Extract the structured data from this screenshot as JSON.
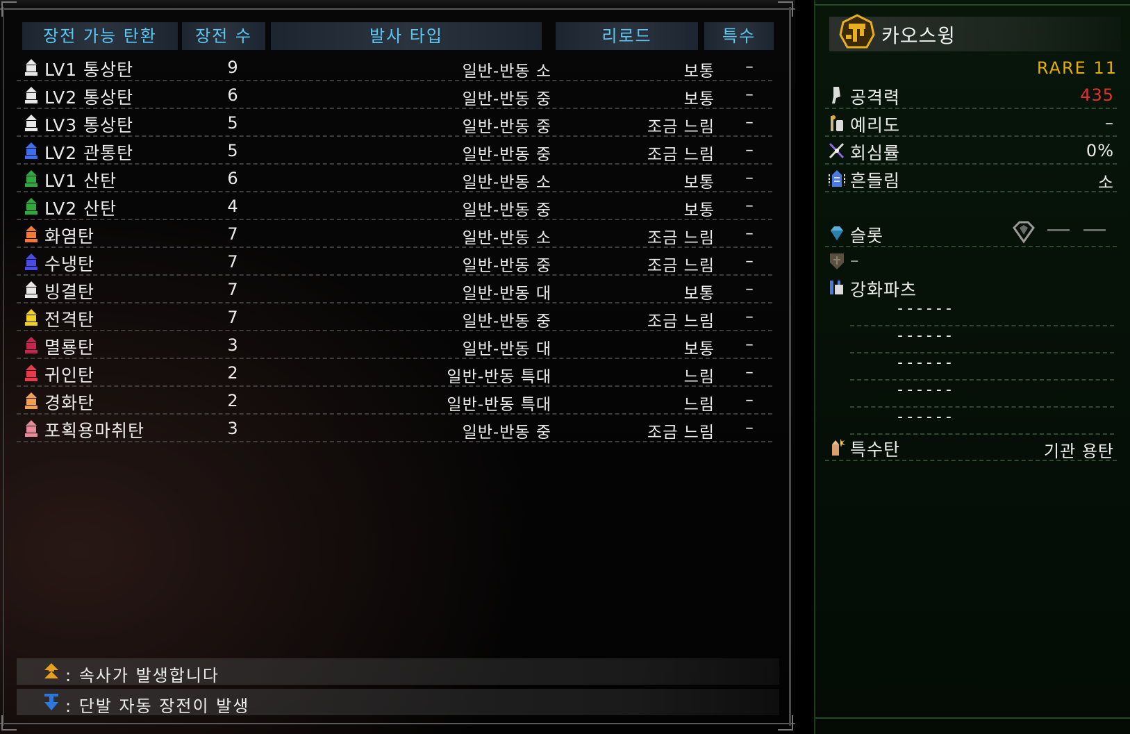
{
  "table": {
    "headers": {
      "ammo": "장전 가능 탄환",
      "capacity": "장전 수",
      "fire_type": "발사 타입",
      "reload": "리로드",
      "special": "특수"
    },
    "rows": [
      {
        "name": "LV1 통상탄",
        "count": "9",
        "fire": "일반-반동 소",
        "reload": "보통",
        "special": "–",
        "color": "#e8e8e8"
      },
      {
        "name": "LV2 통상탄",
        "count": "6",
        "fire": "일반-반동 중",
        "reload": "보통",
        "special": "–",
        "color": "#e8e8e8"
      },
      {
        "name": "LV3 통상탄",
        "count": "5",
        "fire": "일반-반동 중",
        "reload": "조금 느림",
        "special": "–",
        "color": "#e8e8e8"
      },
      {
        "name": "LV2 관통탄",
        "count": "5",
        "fire": "일반-반동 중",
        "reload": "조금 느림",
        "special": "–",
        "color": "#3b6df0"
      },
      {
        "name": "LV1 산탄",
        "count": "6",
        "fire": "일반-반동 소",
        "reload": "보통",
        "special": "–",
        "color": "#2eaa3a"
      },
      {
        "name": "LV2 산탄",
        "count": "4",
        "fire": "일반-반동 중",
        "reload": "보통",
        "special": "–",
        "color": "#2eaa3a"
      },
      {
        "name": "화염탄",
        "count": "7",
        "fire": "일반-반동 소",
        "reload": "조금 느림",
        "special": "–",
        "color": "#f07a3a"
      },
      {
        "name": "수냉탄",
        "count": "7",
        "fire": "일반-반동 중",
        "reload": "조금 느림",
        "special": "–",
        "color": "#4a4ae8"
      },
      {
        "name": "빙결탄",
        "count": "7",
        "fire": "일반-반동 대",
        "reload": "보통",
        "special": "–",
        "color": "#e8e8e8"
      },
      {
        "name": "전격탄",
        "count": "7",
        "fire": "일반-반동 중",
        "reload": "조금 느림",
        "special": "–",
        "color": "#f0d020"
      },
      {
        "name": "멸룡탄",
        "count": "3",
        "fire": "일반-반동 대",
        "reload": "보통",
        "special": "–",
        "color": "#c02850"
      },
      {
        "name": "귀인탄",
        "count": "2",
        "fire": "일반-반동 특대",
        "reload": "느림",
        "special": "–",
        "color": "#e83a4a"
      },
      {
        "name": "경화탄",
        "count": "2",
        "fire": "일반-반동 특대",
        "reload": "느림",
        "special": "–",
        "color": "#f0a050"
      },
      {
        "name": "포획용마취탄",
        "count": "3",
        "fire": "일반-반동 중",
        "reload": "조금 느림",
        "special": "–",
        "color": "#e88a9a"
      }
    ]
  },
  "legend": [
    {
      "icon": "rapid-fire-icon",
      "text": ": 속사가 발생합니다",
      "color": "#e8a020"
    },
    {
      "icon": "auto-reload-icon",
      "text": ": 단발 자동 장전이 발생",
      "color": "#2a78e0"
    }
  ],
  "weapon": {
    "name": "카오스윙",
    "rarity": "RARE 11",
    "emblem_color": "#e8b020",
    "stats": [
      {
        "icon": "attack-icon",
        "label": "공격력",
        "value": "435",
        "value_color": "#e0322c"
      },
      {
        "icon": "sharpness-icon",
        "label": "예리도",
        "value": "–"
      },
      {
        "icon": "affinity-icon",
        "label": "회심률",
        "value": "0%"
      },
      {
        "icon": "deviation-icon",
        "label": "흔들림",
        "value": "소"
      }
    ],
    "slot_label": "슬롯",
    "defense_value": "–",
    "parts_label": "강화파츠",
    "parts": [
      "------",
      "------",
      "------",
      "------",
      "------"
    ],
    "special_ammo_label": "특수탄",
    "special_ammo_value": "기관 용탄"
  }
}
